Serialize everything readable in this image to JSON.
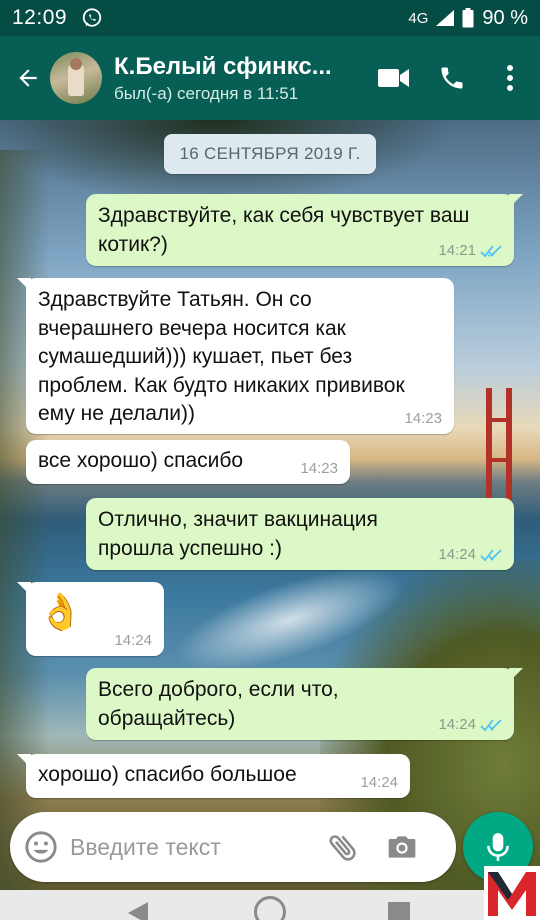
{
  "status_bar": {
    "time": "12:09",
    "network": "4G",
    "battery": "90 %"
  },
  "header": {
    "contact_name": "К.Белый сфинкс...",
    "last_seen": "был(-а) сегодня в 11:51"
  },
  "chat": {
    "date_separator": "16 СЕНТЯБРЯ 2019 Г.",
    "messages": [
      {
        "direction": "out",
        "text": "Здравствуйте, как себя чувствует ваш котик?)",
        "time": "14:21",
        "read": true
      },
      {
        "direction": "in",
        "text": "Здравствуйте Татьян. Он со вчерашнего вечера носится как сумашедший))) кушает, пьет без проблем. Как будто никаких прививок ему не делали))",
        "time": "14:23"
      },
      {
        "direction": "in",
        "text": "все хорошо) спасибо",
        "time": "14:23"
      },
      {
        "direction": "out",
        "text": "Отлично, значит вакцинация прошла успешно :)",
        "time": "14:24",
        "read": true
      },
      {
        "direction": "in",
        "text": "👌",
        "time": "14:24"
      },
      {
        "direction": "out",
        "text": "Всего доброго, если что, обращайтесь)",
        "time": "14:24",
        "read": true
      },
      {
        "direction": "in",
        "text": "хорошо) спасибо большое",
        "time": "14:24"
      }
    ]
  },
  "composer": {
    "placeholder": "Введите текст"
  },
  "icons": {
    "status": [
      "whatsapp-icon",
      "signal-icon",
      "battery-icon"
    ],
    "header": [
      "back-arrow-icon",
      "video-call-icon",
      "phone-icon",
      "more-vert-icon"
    ],
    "composer": [
      "emoji-icon",
      "attach-icon",
      "camera-icon",
      "mic-icon"
    ]
  },
  "colors": {
    "header": "#075e54",
    "status_bar": "#054d44",
    "outgoing_bubble": "#dcf8c6",
    "incoming_bubble": "#ffffff",
    "read_ticks": "#4fc3f7",
    "mic_button": "#00a884"
  }
}
